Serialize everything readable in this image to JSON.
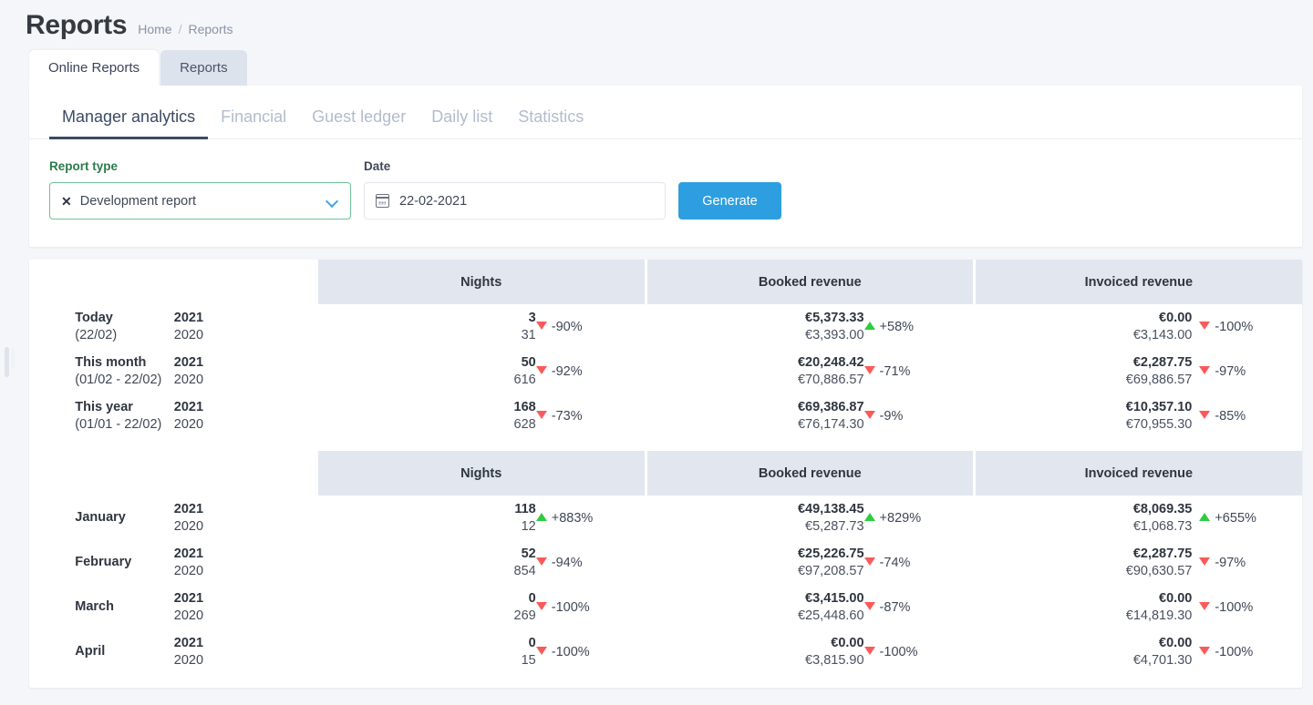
{
  "header": {
    "title": "Reports",
    "breadcrumb": {
      "home": "Home",
      "separator": "/",
      "current": "Reports"
    }
  },
  "outer_tabs": [
    {
      "label": "Online Reports",
      "active": true
    },
    {
      "label": "Reports",
      "active": false
    }
  ],
  "sub_tabs": [
    {
      "label": "Manager analytics",
      "active": true
    },
    {
      "label": "Financial",
      "active": false
    },
    {
      "label": "Guest ledger",
      "active": false
    },
    {
      "label": "Daily list",
      "active": false
    },
    {
      "label": "Statistics",
      "active": false
    }
  ],
  "form": {
    "report_type": {
      "label": "Report type",
      "value": "Development report",
      "clear_glyph": "✕",
      "icon": "chevron-down-icon"
    },
    "date": {
      "label": "Date",
      "value": "22-02-2021",
      "icon": "calendar-icon"
    },
    "generate_label": "Generate"
  },
  "colors": {
    "page_bg": "#f4f6f9",
    "accent_blue": "#2d9fe0",
    "valid_green": "#2c7a4b",
    "header_band": "#e2e7ef",
    "up_green": "#2ecc40",
    "down_red": "#fb5a5a",
    "tab_active": "#3c4a63"
  },
  "report": {
    "column_headers": [
      "Nights",
      "Booked revenue",
      "Invoiced revenue"
    ],
    "sections": [
      {
        "headers": [
          "Nights",
          "Booked revenue",
          "Invoiced revenue"
        ],
        "rows": [
          {
            "name": "Today",
            "sub": "(22/02)",
            "year_current": "2021",
            "year_previous": "2020",
            "metrics": [
              {
                "current": "3",
                "previous": "31",
                "delta": "-90%",
                "dir": "down"
              },
              {
                "current": "€5,373.33",
                "previous": "€3,393.00",
                "delta": "+58%",
                "dir": "up"
              },
              {
                "current": "€0.00",
                "previous": "€3,143.00",
                "delta": "-100%",
                "dir": "down"
              }
            ]
          },
          {
            "name": "This month",
            "sub": "(01/02 - 22/02)",
            "year_current": "2021",
            "year_previous": "2020",
            "metrics": [
              {
                "current": "50",
                "previous": "616",
                "delta": "-92%",
                "dir": "down"
              },
              {
                "current": "€20,248.42",
                "previous": "€70,886.57",
                "delta": "-71%",
                "dir": "down"
              },
              {
                "current": "€2,287.75",
                "previous": "€69,886.57",
                "delta": "-97%",
                "dir": "down"
              }
            ]
          },
          {
            "name": "This year",
            "sub": "(01/01 - 22/02)",
            "year_current": "2021",
            "year_previous": "2020",
            "metrics": [
              {
                "current": "168",
                "previous": "628",
                "delta": "-73%",
                "dir": "down"
              },
              {
                "current": "€69,386.87",
                "previous": "€76,174.30",
                "delta": "-9%",
                "dir": "down"
              },
              {
                "current": "€10,357.10",
                "previous": "€70,955.30",
                "delta": "-85%",
                "dir": "down"
              }
            ]
          }
        ]
      },
      {
        "headers": [
          "Nights",
          "Booked revenue",
          "Invoiced revenue"
        ],
        "rows": [
          {
            "name": "January",
            "sub": "",
            "year_current": "2021",
            "year_previous": "2020",
            "metrics": [
              {
                "current": "118",
                "previous": "12",
                "delta": "+883%",
                "dir": "up"
              },
              {
                "current": "€49,138.45",
                "previous": "€5,287.73",
                "delta": "+829%",
                "dir": "up"
              },
              {
                "current": "€8,069.35",
                "previous": "€1,068.73",
                "delta": "+655%",
                "dir": "up"
              }
            ]
          },
          {
            "name": "February",
            "sub": "",
            "year_current": "2021",
            "year_previous": "2020",
            "metrics": [
              {
                "current": "52",
                "previous": "854",
                "delta": "-94%",
                "dir": "down"
              },
              {
                "current": "€25,226.75",
                "previous": "€97,208.57",
                "delta": "-74%",
                "dir": "down"
              },
              {
                "current": "€2,287.75",
                "previous": "€90,630.57",
                "delta": "-97%",
                "dir": "down"
              }
            ]
          },
          {
            "name": "March",
            "sub": "",
            "year_current": "2021",
            "year_previous": "2020",
            "metrics": [
              {
                "current": "0",
                "previous": "269",
                "delta": "-100%",
                "dir": "down"
              },
              {
                "current": "€3,415.00",
                "previous": "€25,448.60",
                "delta": "-87%",
                "dir": "down"
              },
              {
                "current": "€0.00",
                "previous": "€14,819.30",
                "delta": "-100%",
                "dir": "down"
              }
            ]
          },
          {
            "name": "April",
            "sub": "",
            "year_current": "2021",
            "year_previous": "2020",
            "metrics": [
              {
                "current": "0",
                "previous": "15",
                "delta": "-100%",
                "dir": "down"
              },
              {
                "current": "€0.00",
                "previous": "€3,815.90",
                "delta": "-100%",
                "dir": "down"
              },
              {
                "current": "€0.00",
                "previous": "€4,701.30",
                "delta": "-100%",
                "dir": "down"
              }
            ]
          }
        ]
      }
    ]
  }
}
